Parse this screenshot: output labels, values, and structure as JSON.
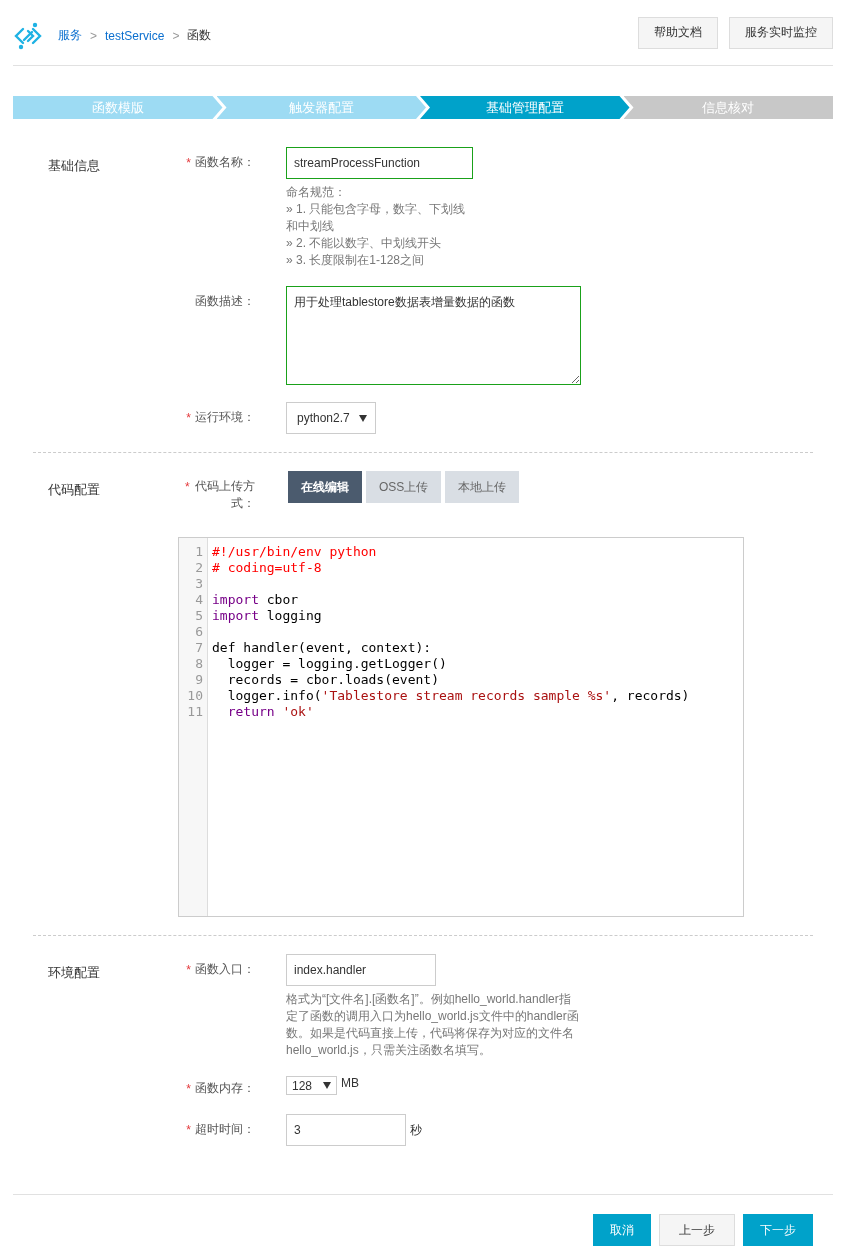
{
  "breadcrumb": [
    {
      "text": "服务",
      "kind": "link"
    },
    {
      "text": ">",
      "kind": "separator"
    },
    {
      "text": "testService",
      "kind": "link"
    },
    {
      "text": ">",
      "kind": "separator"
    },
    {
      "text": "函数",
      "kind": "current"
    }
  ],
  "header_buttons": [
    "帮助文档",
    "服务实时监控"
  ],
  "steps": [
    {
      "label": "函数模版",
      "completed": true,
      "selected": false
    },
    {
      "label": "触发器配置",
      "completed": true,
      "selected": false
    },
    {
      "label": "基础管理配置",
      "completed": false,
      "selected": true
    },
    {
      "label": "信息核对",
      "completed": false,
      "selected": false
    }
  ],
  "sections": [
    {
      "title": "基础信息",
      "fields": [
        {
          "kind": "input",
          "required_mark": "*",
          "label": "函数名称：",
          "value": "streamProcessFunction",
          "focused": true,
          "hint": [
            "命名规范：",
            "» 1. 只能包含字母，数字、下划线",
            "和中划线",
            "» 2. 不能以数字、中划线开头",
            "» 3. 长度限制在1-128之间"
          ]
        },
        {
          "kind": "textarea",
          "label": "函数描述：",
          "value": "用于处理tablestore数据表增量数据的函数",
          "focused": true
        },
        {
          "kind": "select",
          "required_mark": "*",
          "label": "运行环境：",
          "value": "python2.7"
        }
      ]
    },
    {
      "title": "代码配置",
      "fields": [
        {
          "kind": "tabs",
          "required_mark": "*",
          "label": "代码上传方式：",
          "options": [
            {
              "label": "在线编辑",
              "selected": true
            },
            {
              "label": "OSS上传",
              "selected": false
            },
            {
              "label": "本地上传",
              "selected": false
            }
          ]
        },
        {
          "kind": "code",
          "lines": [
            {
              "number": "1",
              "tokens": [
                {
                  "t": "#!/usr/bin/env python",
                  "kind": "comment"
                }
              ]
            },
            {
              "number": "2",
              "tokens": [
                {
                  "t": "# coding=utf-8",
                  "kind": "comment"
                }
              ]
            },
            {
              "number": "3"
            },
            {
              "number": "4",
              "tokens": [
                {
                  "t": "import",
                  "kind": "keyword"
                },
                {
                  "t": " cbor",
                  "kind": "plain"
                }
              ]
            },
            {
              "number": "5",
              "tokens": [
                {
                  "t": "import",
                  "kind": "keyword"
                },
                {
                  "t": " logging",
                  "kind": "plain"
                }
              ]
            },
            {
              "number": "6"
            },
            {
              "number": "7",
              "tokens": [
                {
                  "t": "def handler(event, context):",
                  "kind": "plain"
                }
              ]
            },
            {
              "number": "8",
              "tokens": [
                {
                  "t": "  logger = logging.getLogger()",
                  "kind": "plain"
                }
              ]
            },
            {
              "number": "9",
              "tokens": [
                {
                  "t": "  records = cbor.loads(event)",
                  "kind": "plain"
                }
              ]
            },
            {
              "number": "10",
              "tokens": [
                {
                  "t": "  logger.info(",
                  "kind": "plain"
                },
                {
                  "t": "'Tablestore stream records sample %s'",
                  "kind": "string"
                },
                {
                  "t": ", records)",
                  "kind": "plain"
                }
              ]
            },
            {
              "number": "11",
              "tokens": [
                {
                  "t": "  return",
                  "kind": "keyword"
                },
                {
                  "t": " 'ok'",
                  "kind": "string"
                }
              ]
            }
          ]
        }
      ]
    },
    {
      "title": "环境配置",
      "fields": [
        {
          "kind": "input",
          "required_mark": "*",
          "label": "函数入口：",
          "value": "index.handler",
          "focused": false,
          "hint": [
            "格式为“[文件名].[函数名]”。例如hello_world.handler指",
            "定了函数的调用入口为hello_world.js文件中的handler函",
            "数。如果是代码直接上传，代码将保存为对应的文件名",
            "hello_world.js，只需关注函数名填写。"
          ]
        },
        {
          "kind": "select",
          "required_mark": "*",
          "label": "函数内存：",
          "value": "128",
          "unit": "MB"
        },
        {
          "kind": "input",
          "required_mark": "*",
          "label": "超时时间：",
          "value": "3",
          "focused": false,
          "unit": "秒"
        }
      ]
    }
  ],
  "footer_buttons": [
    {
      "label": "取消",
      "kind": "primary"
    },
    {
      "label": "上一步",
      "kind": "default"
    },
    {
      "label": "下一步",
      "kind": "primary"
    }
  ]
}
